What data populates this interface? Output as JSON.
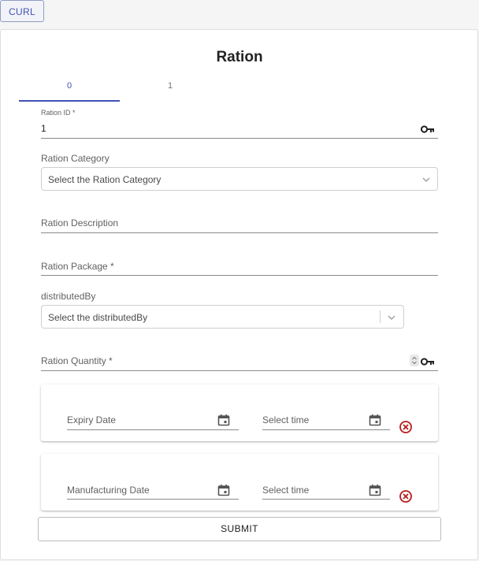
{
  "toolbar": {
    "curl_label": "CURL"
  },
  "form": {
    "title": "Ration",
    "tabs": [
      {
        "label": "0"
      },
      {
        "label": "1"
      }
    ],
    "active_tab": 0,
    "ration_id": {
      "label": "Ration ID *",
      "value": "1",
      "icon": "key-icon"
    },
    "ration_category": {
      "label": "Ration Category",
      "placeholder": "Select the Ration Category"
    },
    "ration_description": {
      "label": "Ration Description",
      "value": ""
    },
    "ration_package": {
      "label": "Ration Package *",
      "value": ""
    },
    "distributed_by": {
      "label": "distributedBy",
      "placeholder": "Select the distributedBy"
    },
    "ration_quantity": {
      "label": "Ration Quantity *",
      "value": "",
      "icon": "key-icon"
    },
    "expiry": {
      "date_label": "Expiry Date",
      "time_label": "Select time"
    },
    "manufacturing": {
      "date_label": "Manufacturing Date",
      "time_label": "Select time"
    },
    "submit_label": "SUBMIT"
  },
  "colors": {
    "accent": "#3f51b5",
    "clear_icon": "#b71c1c",
    "text": "#212121",
    "muted_text": "#616161"
  }
}
